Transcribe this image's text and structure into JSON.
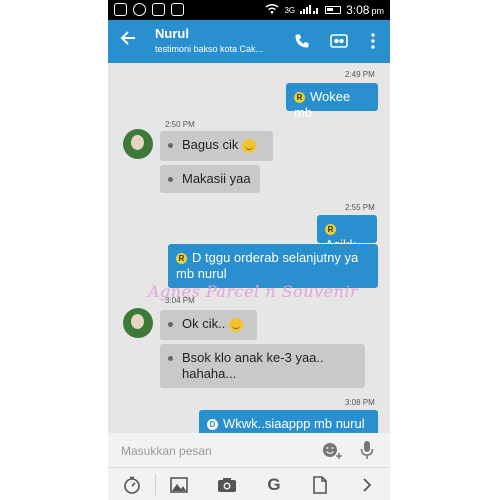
{
  "status_bar": {
    "network": "3G",
    "time": "3:08",
    "ampm": "pm"
  },
  "header": {
    "title": "Nurul",
    "subtitle": "testimoni bakso kota Cak..."
  },
  "messages": [
    {
      "time": "2:49 PM",
      "text": "Wokee mb",
      "badge": "R"
    },
    {
      "time": "2:50 PM",
      "text": "Bagus cik"
    },
    {
      "text": "Makasii yaa"
    },
    {
      "time": "2:55 PM",
      "text": "Asikk",
      "badge": "R"
    },
    {
      "line1": "D tggu orderab selanjutny ya",
      "line2": "mb nurul",
      "badge": "R"
    },
    {
      "time": "3:04 PM",
      "text": "Ok cik.."
    },
    {
      "line1": "Bsok klo anak ke-3 yaa..",
      "line2": "hahaha..."
    },
    {
      "time": "3:08 PM",
      "text": "Wkwk..siaappp mb nurul",
      "badge": "D"
    }
  ],
  "watermark": "Agnes Parcel n Souvenir",
  "composer": {
    "placeholder": "Masukkan pesan"
  },
  "toolbar": {
    "google_label": "G"
  }
}
